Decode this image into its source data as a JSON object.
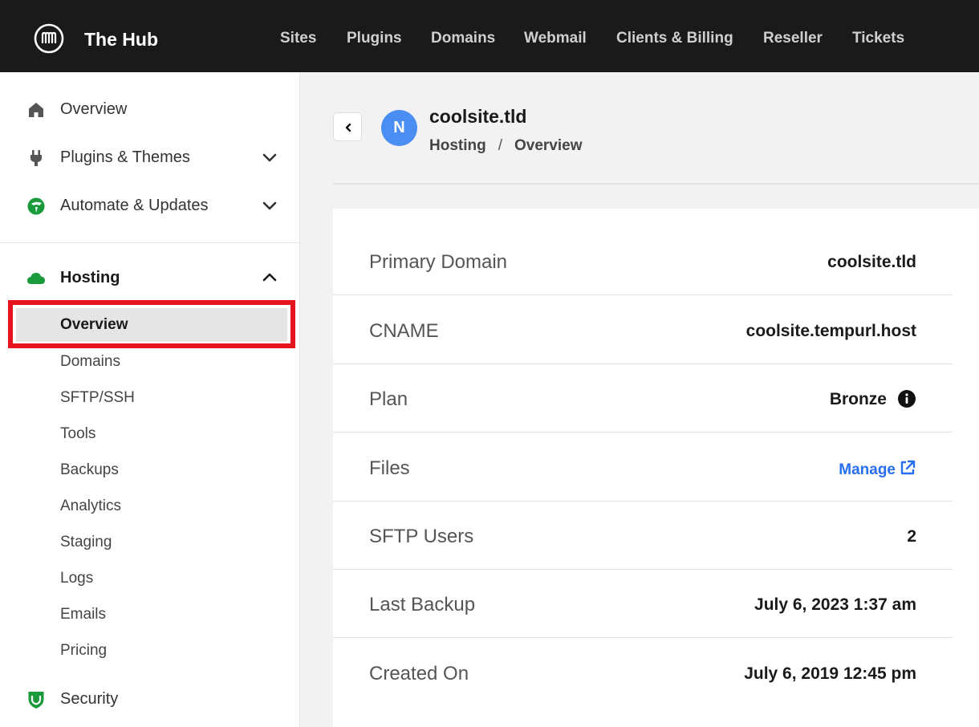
{
  "app": {
    "title": "The Hub",
    "logo_icon": "wpmudev-logo-icon"
  },
  "topnav": {
    "items": [
      {
        "label": "Sites"
      },
      {
        "label": "Plugins"
      },
      {
        "label": "Domains"
      },
      {
        "label": "Webmail"
      },
      {
        "label": "Clients & Billing"
      },
      {
        "label": "Reseller"
      },
      {
        "label": "Tickets"
      }
    ]
  },
  "sidebar": {
    "items": [
      {
        "label": "Overview",
        "icon": "home-icon"
      },
      {
        "label": "Plugins & Themes",
        "icon": "plug-icon",
        "expandable": true
      },
      {
        "label": "Automate & Updates",
        "icon": "automate-icon",
        "expandable": true
      }
    ],
    "hosting": {
      "label": "Hosting",
      "icon": "cloud-icon",
      "expanded": true,
      "subitems": [
        {
          "label": "Overview",
          "active": true
        },
        {
          "label": "Domains"
        },
        {
          "label": "SFTP/SSH"
        },
        {
          "label": "Tools"
        },
        {
          "label": "Backups"
        },
        {
          "label": "Analytics"
        },
        {
          "label": "Staging"
        },
        {
          "label": "Logs"
        },
        {
          "label": "Emails"
        },
        {
          "label": "Pricing"
        }
      ]
    },
    "security": {
      "label": "Security",
      "icon": "shield-icon"
    }
  },
  "header": {
    "avatar_letter": "N",
    "site_title": "coolsite.tld",
    "breadcrumb": [
      "Hosting",
      "Overview"
    ],
    "separator": "/"
  },
  "details": {
    "rows": [
      {
        "label": "Primary Domain",
        "value": "coolsite.tld"
      },
      {
        "label": "CNAME",
        "value": "coolsite.tempurl.host"
      },
      {
        "label": "Plan",
        "value": "Bronze"
      },
      {
        "label": "Files",
        "value": "Manage"
      },
      {
        "label": "SFTP Users",
        "value": "2"
      },
      {
        "label": "Last Backup",
        "value": "July 6, 2023 1:37 am"
      },
      {
        "label": "Created On",
        "value": "July 6, 2019 12:45 pm"
      }
    ]
  },
  "colors": {
    "topbar": "#1a1a1a",
    "accent_blue": "#286ef0",
    "avatar_blue": "#4b8ef3",
    "hosting_green": "#1a9a3a",
    "highlight_red": "#e4151f"
  }
}
